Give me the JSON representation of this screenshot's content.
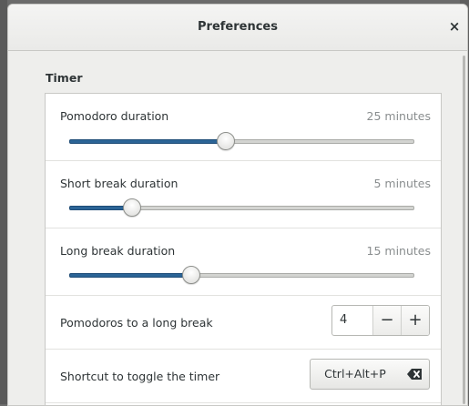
{
  "window": {
    "title": "Preferences",
    "close_glyph": "×"
  },
  "timer": {
    "section_title": "Timer",
    "pomodoro": {
      "label": "Pomodoro duration",
      "value_text": "25 minutes",
      "level": 0.45
    },
    "short_break": {
      "label": "Short break duration",
      "value_text": "5 minutes",
      "level": 0.18
    },
    "long_break": {
      "label": "Long break duration",
      "value_text": "15 minutes",
      "level": 0.35
    },
    "pomodoros_to_long_break": {
      "label": "Pomodoros to a long break",
      "value": "4",
      "decrement_glyph": "−",
      "increment_glyph": "+"
    },
    "shortcut": {
      "label": "Shortcut to toggle the timer",
      "value": "Ctrl+Alt+P",
      "clear_icon": "backspace-icon"
    }
  },
  "colors": {
    "accent": "#2b6496",
    "dialog_bg": "#eeeeec",
    "muted_text": "#8a8e8f"
  }
}
